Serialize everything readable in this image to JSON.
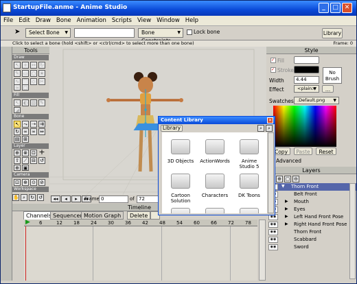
{
  "window": {
    "title": "StartupFile.anme - Anime Studio"
  },
  "menu": [
    "File",
    "Edit",
    "Draw",
    "Bone",
    "Animation",
    "Scripts",
    "View",
    "Window",
    "Help"
  ],
  "toolbar": {
    "select_bone": "Select Bone",
    "bone_constraints": "Bone Constraints",
    "lock_bone": "Lock bone",
    "library": "Library"
  },
  "status": {
    "text": "Click to select a bone (hold <shift> or <ctrl/cmd> to select more than one bone)",
    "frame": "Frame: 0"
  },
  "tools": {
    "title": "Tools",
    "sections": [
      "Draw",
      "Fill",
      "Bone",
      "Layer",
      "Camera",
      "Workspace"
    ]
  },
  "frame_bar": {
    "frame_label": "Frame",
    "frame_value": "0",
    "of_label": "of",
    "total": "72"
  },
  "timeline": {
    "title": "Timeline",
    "tabs": [
      "Channels",
      "Sequencer",
      "Motion Graph"
    ],
    "delete": "Delete",
    "ticks": [
      "6",
      "12",
      "18",
      "24",
      "30",
      "36",
      "42",
      "48",
      "54",
      "60",
      "66",
      "72",
      "78"
    ]
  },
  "style": {
    "title": "Style",
    "fill": "Fill",
    "stroke": "Stroke",
    "width_label": "Width",
    "width_value": "4.44",
    "no_brush": "No Brush",
    "effect_label": "Effect",
    "effect_value": "<plain>",
    "swatches_label": "Swatches",
    "swatches_value": ".Default.png",
    "copy": "Copy",
    "paste": "Paste",
    "reset": "Reset",
    "advanced": "Advanced"
  },
  "layers": {
    "title": "Layers",
    "items": [
      "Thorn Front",
      "Belt Front",
      "Mouth",
      "Eyes",
      "Left Hand Front Pose",
      "Right Hand Front Pose",
      "Thorn Front",
      "Scabbard",
      "Sword"
    ]
  },
  "library": {
    "title": "Content Library",
    "tab": "Library",
    "folders": [
      "3D Objects",
      "ActionWords",
      "Anime Studio 5",
      "Cartoon Solution",
      "Characters",
      "DK Toons"
    ]
  },
  "colors": {
    "title_blue": "#0a4ad8",
    "canvas": "#d8d6d0",
    "selected_layer": "#5566aa"
  }
}
